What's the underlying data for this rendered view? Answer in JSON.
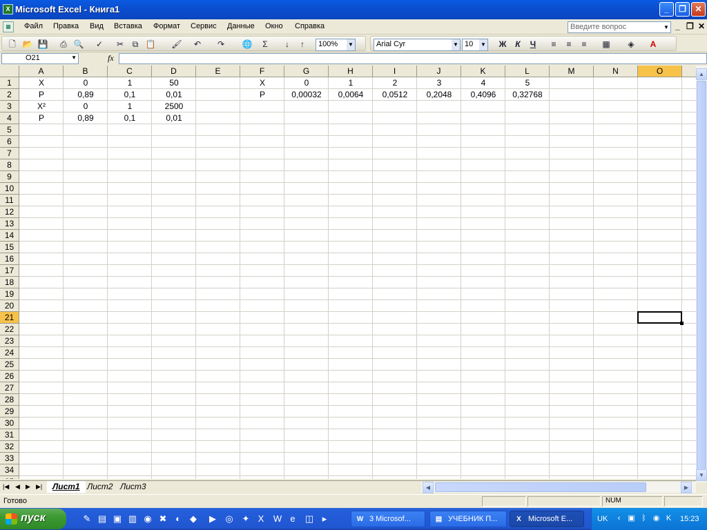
{
  "window": {
    "title": "Microsoft Excel - Книга1",
    "app_icon": "excel-icon"
  },
  "menu": {
    "items": [
      "Файл",
      "Правка",
      "Вид",
      "Вставка",
      "Формат",
      "Сервис",
      "Данные",
      "Окно",
      "Справка"
    ],
    "help_placeholder": "Введите вопрос"
  },
  "toolbar": {
    "zoom": "100%",
    "font": "Arial Cyr",
    "size": "10",
    "bold": "Ж",
    "italic": "К",
    "underline": "Ч"
  },
  "formula_bar": {
    "name_box": "O21",
    "fx": "fx",
    "formula": ""
  },
  "grid": {
    "columns": [
      "A",
      "B",
      "C",
      "D",
      "E",
      "F",
      "G",
      "H",
      "I",
      "J",
      "K",
      "L",
      "M",
      "N",
      "O"
    ],
    "selected_column": "O",
    "selected_row": 21,
    "active_cell": "O21",
    "rows": 35,
    "cells": [
      {
        "ref": "A1",
        "text": "X"
      },
      {
        "ref": "B1",
        "text": "0"
      },
      {
        "ref": "C1",
        "text": "1"
      },
      {
        "ref": "D1",
        "text": "50"
      },
      {
        "ref": "F1",
        "text": "X"
      },
      {
        "ref": "G1",
        "text": "0"
      },
      {
        "ref": "H1",
        "text": "1"
      },
      {
        "ref": "I1",
        "text": "2"
      },
      {
        "ref": "J1",
        "text": "3"
      },
      {
        "ref": "K1",
        "text": "4"
      },
      {
        "ref": "L1",
        "text": "5"
      },
      {
        "ref": "A2",
        "text": "P"
      },
      {
        "ref": "B2",
        "text": "0,89"
      },
      {
        "ref": "C2",
        "text": "0,1"
      },
      {
        "ref": "D2",
        "text": "0,01"
      },
      {
        "ref": "F2",
        "text": "P"
      },
      {
        "ref": "G2",
        "text": "0,00032"
      },
      {
        "ref": "H2",
        "text": "0,0064"
      },
      {
        "ref": "I2",
        "text": "0,0512"
      },
      {
        "ref": "J2",
        "text": "0,2048"
      },
      {
        "ref": "K2",
        "text": "0,4096"
      },
      {
        "ref": "L2",
        "text": "0,32768"
      },
      {
        "ref": "A3",
        "text": "X²"
      },
      {
        "ref": "B3",
        "text": "0"
      },
      {
        "ref": "C3",
        "text": "1"
      },
      {
        "ref": "D3",
        "text": "2500"
      },
      {
        "ref": "A4",
        "text": "P"
      },
      {
        "ref": "B4",
        "text": "0,89"
      },
      {
        "ref": "C4",
        "text": "0,1"
      },
      {
        "ref": "D4",
        "text": "0,01"
      }
    ]
  },
  "sheet_tabs": [
    "Лист1",
    "Лист2",
    "Лист3"
  ],
  "active_tab": "Лист1",
  "status": {
    "text": "Готово",
    "num": "NUM"
  },
  "taskbar": {
    "start": "пуск",
    "buttons": [
      {
        "label": "3 Microsof...",
        "icon": "word-icon"
      },
      {
        "label": "УЧЕБНИК П...",
        "icon": "folder-icon"
      },
      {
        "label": "Microsoft E...",
        "icon": "excel-icon",
        "active": true
      }
    ],
    "lang": "UK",
    "clock": "15:23"
  },
  "colors": {
    "selection": "#f7c24a",
    "title_bar": "#0a5be3",
    "taskbar": "#245edb",
    "start": "#3c9a32"
  }
}
